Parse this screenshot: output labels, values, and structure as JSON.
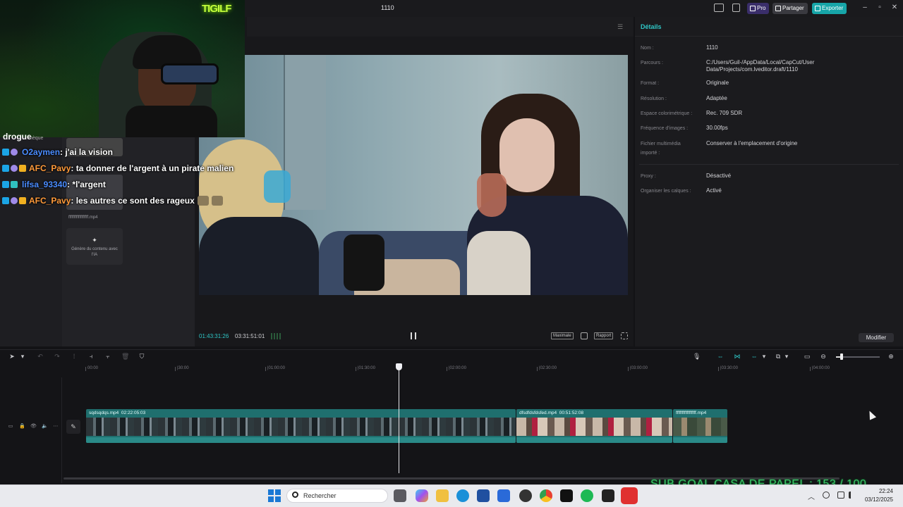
{
  "window": {
    "title": "1110",
    "pro_label": "Pro",
    "share_label": "Partager",
    "export_label": "Exporter",
    "accent": "#2fc7c7"
  },
  "webcam": {
    "logo": "TIGILF"
  },
  "chat": {
    "header": "drogue",
    "header_sub": "thèque",
    "lines": [
      {
        "user": "O2aymen",
        "user_color": "#4a8cff",
        "text": ": j'ai la vision"
      },
      {
        "user": "AFC_Pavy",
        "user_color": "#ff9a3a",
        "text": ": ta donner de l'argent à un pirate malien"
      },
      {
        "user": "lifsa_93340",
        "user_color": "#4a8cff",
        "text": ": *l'argent"
      },
      {
        "user": "AFC_Pavy",
        "user_color": "#ff9a3a",
        "text": ": les autres ce sont des rageux"
      }
    ]
  },
  "media": {
    "clip_caption": "ffffffffffffffffff.mp4",
    "generate_label": "Génère du contenu avec l'IA"
  },
  "player": {
    "current_time": "01:43:31:26",
    "total_time": "03:31:51:01",
    "maximize_label": "Maximale",
    "ratio_label": "Rapport"
  },
  "details": {
    "title": "Détails",
    "rows": [
      {
        "label": "Nom :",
        "value": "1110"
      },
      {
        "label": "Parcours :",
        "value": "C:/Users/Guil-/AppData/Local/CapCut/User Data/Projects/com.lveditor.draft/1110"
      },
      {
        "label": "Format :",
        "value": "Originale"
      },
      {
        "label": "Résolution :",
        "value": "Adaptée"
      },
      {
        "label": "Espace colorimétrique :",
        "value": "Rec. 709 SDR"
      },
      {
        "label": "Fréquence d'images :",
        "value": "30.00fps"
      },
      {
        "label": "Fichier multimédia importé :",
        "value": "Conserver à l'emplacement d'origine"
      },
      {
        "label": "Proxy :",
        "value": "Désactivé"
      },
      {
        "label": "Organiser les calques :",
        "value": "Activé"
      }
    ],
    "modify_label": "Modifier"
  },
  "timeline": {
    "ticks": [
      "00:00",
      "|30:00",
      "|01:00:00",
      "|01:30:00",
      "|02:00:00",
      "|02:30:00",
      "|03:00:00",
      "|03:30:00",
      "|04:00:00"
    ],
    "clips": [
      {
        "name": "sqdsqdqs.mp4",
        "duration": "02:22:05:03"
      },
      {
        "name": "dfsdfdsfdsfed.mp4",
        "duration": "00:51:52:08"
      },
      {
        "name": "fffffffffffffffff.mp4",
        "duration": ""
      }
    ]
  },
  "overlay": {
    "sub_goal": "SUB GOAL CASA DE PAPEL : 153 / 100"
  },
  "taskbar": {
    "search_placeholder": "Rechercher",
    "time": "22:24",
    "date": "03/12/2025"
  }
}
